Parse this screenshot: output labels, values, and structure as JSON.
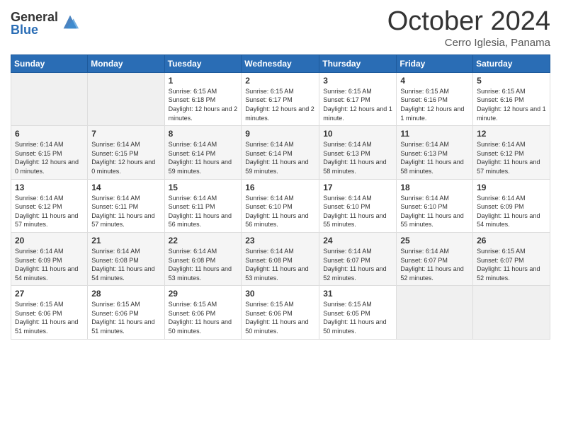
{
  "logo": {
    "general": "General",
    "blue": "Blue"
  },
  "header": {
    "month": "October 2024",
    "location": "Cerro Iglesia, Panama"
  },
  "weekdays": [
    "Sunday",
    "Monday",
    "Tuesday",
    "Wednesday",
    "Thursday",
    "Friday",
    "Saturday"
  ],
  "weeks": [
    [
      {
        "day": "",
        "sunrise": "",
        "sunset": "",
        "daylight": "",
        "empty": true
      },
      {
        "day": "",
        "sunrise": "",
        "sunset": "",
        "daylight": "",
        "empty": true
      },
      {
        "day": "1",
        "sunrise": "Sunrise: 6:15 AM",
        "sunset": "Sunset: 6:18 PM",
        "daylight": "Daylight: 12 hours and 2 minutes."
      },
      {
        "day": "2",
        "sunrise": "Sunrise: 6:15 AM",
        "sunset": "Sunset: 6:17 PM",
        "daylight": "Daylight: 12 hours and 2 minutes."
      },
      {
        "day": "3",
        "sunrise": "Sunrise: 6:15 AM",
        "sunset": "Sunset: 6:17 PM",
        "daylight": "Daylight: 12 hours and 1 minute."
      },
      {
        "day": "4",
        "sunrise": "Sunrise: 6:15 AM",
        "sunset": "Sunset: 6:16 PM",
        "daylight": "Daylight: 12 hours and 1 minute."
      },
      {
        "day": "5",
        "sunrise": "Sunrise: 6:15 AM",
        "sunset": "Sunset: 6:16 PM",
        "daylight": "Daylight: 12 hours and 1 minute."
      }
    ],
    [
      {
        "day": "6",
        "sunrise": "Sunrise: 6:14 AM",
        "sunset": "Sunset: 6:15 PM",
        "daylight": "Daylight: 12 hours and 0 minutes."
      },
      {
        "day": "7",
        "sunrise": "Sunrise: 6:14 AM",
        "sunset": "Sunset: 6:15 PM",
        "daylight": "Daylight: 12 hours and 0 minutes."
      },
      {
        "day": "8",
        "sunrise": "Sunrise: 6:14 AM",
        "sunset": "Sunset: 6:14 PM",
        "daylight": "Daylight: 11 hours and 59 minutes."
      },
      {
        "day": "9",
        "sunrise": "Sunrise: 6:14 AM",
        "sunset": "Sunset: 6:14 PM",
        "daylight": "Daylight: 11 hours and 59 minutes."
      },
      {
        "day": "10",
        "sunrise": "Sunrise: 6:14 AM",
        "sunset": "Sunset: 6:13 PM",
        "daylight": "Daylight: 11 hours and 58 minutes."
      },
      {
        "day": "11",
        "sunrise": "Sunrise: 6:14 AM",
        "sunset": "Sunset: 6:13 PM",
        "daylight": "Daylight: 11 hours and 58 minutes."
      },
      {
        "day": "12",
        "sunrise": "Sunrise: 6:14 AM",
        "sunset": "Sunset: 6:12 PM",
        "daylight": "Daylight: 11 hours and 57 minutes."
      }
    ],
    [
      {
        "day": "13",
        "sunrise": "Sunrise: 6:14 AM",
        "sunset": "Sunset: 6:12 PM",
        "daylight": "Daylight: 11 hours and 57 minutes."
      },
      {
        "day": "14",
        "sunrise": "Sunrise: 6:14 AM",
        "sunset": "Sunset: 6:11 PM",
        "daylight": "Daylight: 11 hours and 57 minutes."
      },
      {
        "day": "15",
        "sunrise": "Sunrise: 6:14 AM",
        "sunset": "Sunset: 6:11 PM",
        "daylight": "Daylight: 11 hours and 56 minutes."
      },
      {
        "day": "16",
        "sunrise": "Sunrise: 6:14 AM",
        "sunset": "Sunset: 6:10 PM",
        "daylight": "Daylight: 11 hours and 56 minutes."
      },
      {
        "day": "17",
        "sunrise": "Sunrise: 6:14 AM",
        "sunset": "Sunset: 6:10 PM",
        "daylight": "Daylight: 11 hours and 55 minutes."
      },
      {
        "day": "18",
        "sunrise": "Sunrise: 6:14 AM",
        "sunset": "Sunset: 6:10 PM",
        "daylight": "Daylight: 11 hours and 55 minutes."
      },
      {
        "day": "19",
        "sunrise": "Sunrise: 6:14 AM",
        "sunset": "Sunset: 6:09 PM",
        "daylight": "Daylight: 11 hours and 54 minutes."
      }
    ],
    [
      {
        "day": "20",
        "sunrise": "Sunrise: 6:14 AM",
        "sunset": "Sunset: 6:09 PM",
        "daylight": "Daylight: 11 hours and 54 minutes."
      },
      {
        "day": "21",
        "sunrise": "Sunrise: 6:14 AM",
        "sunset": "Sunset: 6:08 PM",
        "daylight": "Daylight: 11 hours and 54 minutes."
      },
      {
        "day": "22",
        "sunrise": "Sunrise: 6:14 AM",
        "sunset": "Sunset: 6:08 PM",
        "daylight": "Daylight: 11 hours and 53 minutes."
      },
      {
        "day": "23",
        "sunrise": "Sunrise: 6:14 AM",
        "sunset": "Sunset: 6:08 PM",
        "daylight": "Daylight: 11 hours and 53 minutes."
      },
      {
        "day": "24",
        "sunrise": "Sunrise: 6:14 AM",
        "sunset": "Sunset: 6:07 PM",
        "daylight": "Daylight: 11 hours and 52 minutes."
      },
      {
        "day": "25",
        "sunrise": "Sunrise: 6:14 AM",
        "sunset": "Sunset: 6:07 PM",
        "daylight": "Daylight: 11 hours and 52 minutes."
      },
      {
        "day": "26",
        "sunrise": "Sunrise: 6:15 AM",
        "sunset": "Sunset: 6:07 PM",
        "daylight": "Daylight: 11 hours and 52 minutes."
      }
    ],
    [
      {
        "day": "27",
        "sunrise": "Sunrise: 6:15 AM",
        "sunset": "Sunset: 6:06 PM",
        "daylight": "Daylight: 11 hours and 51 minutes."
      },
      {
        "day": "28",
        "sunrise": "Sunrise: 6:15 AM",
        "sunset": "Sunset: 6:06 PM",
        "daylight": "Daylight: 11 hours and 51 minutes."
      },
      {
        "day": "29",
        "sunrise": "Sunrise: 6:15 AM",
        "sunset": "Sunset: 6:06 PM",
        "daylight": "Daylight: 11 hours and 50 minutes."
      },
      {
        "day": "30",
        "sunrise": "Sunrise: 6:15 AM",
        "sunset": "Sunset: 6:06 PM",
        "daylight": "Daylight: 11 hours and 50 minutes."
      },
      {
        "day": "31",
        "sunrise": "Sunrise: 6:15 AM",
        "sunset": "Sunset: 6:05 PM",
        "daylight": "Daylight: 11 hours and 50 minutes."
      },
      {
        "day": "",
        "sunrise": "",
        "sunset": "",
        "daylight": "",
        "empty": true
      },
      {
        "day": "",
        "sunrise": "",
        "sunset": "",
        "daylight": "",
        "empty": true
      }
    ]
  ]
}
